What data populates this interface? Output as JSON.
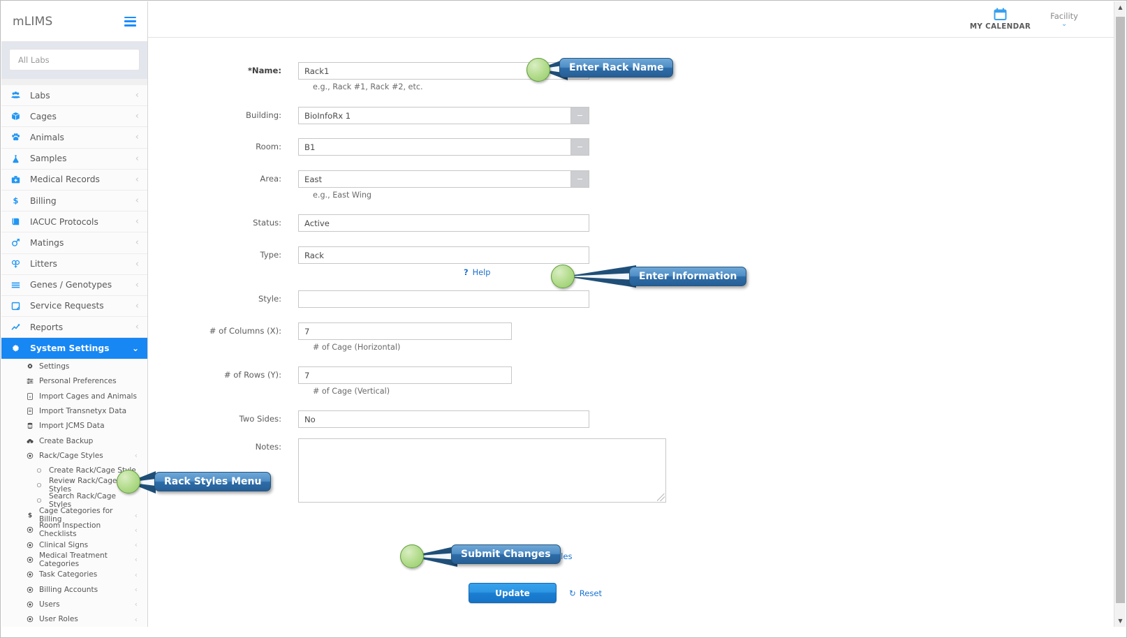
{
  "sidebar": {
    "brand": "mLIMS",
    "hamburger_icon": "hamburger-menu-icon",
    "lab_selector": {
      "value": "All Labs",
      "placeholder": "All Labs"
    },
    "nav_items": [
      {
        "label": "Labs",
        "icon": "users-group-icon",
        "chevron": "‹"
      },
      {
        "label": "Cages",
        "icon": "box-icon",
        "chevron": "‹"
      },
      {
        "label": "Animals",
        "icon": "paw-icon",
        "chevron": "‹"
      },
      {
        "label": "Samples",
        "icon": "flask-icon",
        "chevron": "‹"
      },
      {
        "label": "Medical Records",
        "icon": "medkit-icon",
        "chevron": "‹"
      },
      {
        "label": "Billing",
        "icon": "dollar-icon",
        "chevron": "‹"
      },
      {
        "label": "IACUC Protocols",
        "icon": "book-icon",
        "chevron": "‹"
      },
      {
        "label": "Matings",
        "icon": "mars-venus-icon",
        "chevron": "‹"
      },
      {
        "label": "Litters",
        "icon": "venus-double-icon",
        "chevron": "‹"
      },
      {
        "label": "Genes / Genotypes",
        "icon": "bars-icon",
        "chevron": "‹"
      },
      {
        "label": "Service Requests",
        "icon": "note-icon",
        "chevron": "‹"
      },
      {
        "label": "Reports",
        "icon": "line-chart-icon",
        "chevron": "‹"
      }
    ],
    "active_item": {
      "label": "System Settings",
      "icon": "gear-icon",
      "chevron": "⌄"
    },
    "sub_items": [
      {
        "label": "Settings",
        "icon": "gear-icon",
        "chevron": "",
        "deep": false
      },
      {
        "label": "Personal Preferences",
        "icon": "sliders-icon",
        "chevron": "",
        "deep": false
      },
      {
        "label": "Import Cages and Animals",
        "icon": "file-excel-icon",
        "chevron": "",
        "deep": false
      },
      {
        "label": "Import Transnetyx Data",
        "icon": "file-icon",
        "chevron": "",
        "deep": false
      },
      {
        "label": "Import JCMS Data",
        "icon": "database-icon",
        "chevron": "",
        "deep": false
      },
      {
        "label": "Create Backup",
        "icon": "cloud-download-icon",
        "chevron": "",
        "deep": false
      },
      {
        "label": "Rack/Cage Styles",
        "icon": "dot-circle-icon",
        "chevron": "‹",
        "deep": false
      },
      {
        "label": "Create Rack/Cage Style",
        "icon": "circle-o-icon",
        "chevron": "",
        "deep": true
      },
      {
        "label": "Review Rack/Cage Styles",
        "icon": "circle-o-icon",
        "chevron": "",
        "deep": true
      },
      {
        "label": "Search Rack/Cage Styles",
        "icon": "circle-o-icon",
        "chevron": "",
        "deep": true
      },
      {
        "label": "Cage Categories for Billing",
        "icon": "dollar-icon",
        "chevron": "‹",
        "deep": false
      },
      {
        "label": "Room Inspection Checklists",
        "icon": "dot-circle-icon",
        "chevron": "‹",
        "deep": false
      },
      {
        "label": "Clinical Signs",
        "icon": "dot-circle-icon",
        "chevron": "‹",
        "deep": false
      },
      {
        "label": "Medical Treatment Categories",
        "icon": "dot-circle-icon",
        "chevron": "‹",
        "deep": false
      },
      {
        "label": "Task Categories",
        "icon": "dot-circle-icon",
        "chevron": "‹",
        "deep": false
      },
      {
        "label": "Billing Accounts",
        "icon": "dot-circle-icon",
        "chevron": "‹",
        "deep": false
      },
      {
        "label": "Users",
        "icon": "dot-circle-icon",
        "chevron": "‹",
        "deep": false
      },
      {
        "label": "User Roles",
        "icon": "dot-circle-icon",
        "chevron": "‹",
        "deep": false
      }
    ]
  },
  "topbar": {
    "calendar_label": "MY CALENDAR",
    "calendar_icon": "calendar-icon",
    "facility_label": "Facility",
    "facility_chevron": "⌄"
  },
  "form": {
    "name": {
      "label": "*Name:",
      "value": "Rack1",
      "hint": "e.g., Rack #1, Rack #2, etc."
    },
    "building": {
      "label": "Building:",
      "value": "BioInfoRx 1",
      "hint": ""
    },
    "room": {
      "label": "Room:",
      "value": "B1",
      "hint": ""
    },
    "area": {
      "label": "Area:",
      "value": "East",
      "hint": "e.g., East Wing"
    },
    "status": {
      "label": "Status:",
      "value": "Active",
      "hint": ""
    },
    "type": {
      "label": "Type:",
      "value": "Rack",
      "hint": ""
    },
    "help": {
      "marker": "?",
      "label": "Help"
    },
    "style": {
      "label": "Style:",
      "value": "",
      "hint": ""
    },
    "columns": {
      "label": "# of Columns (X):",
      "value": "7",
      "hint": "# of Cage (Horizontal)"
    },
    "rows": {
      "label": "# of Rows (Y):",
      "value": "7",
      "hint": "# of Cage (Vertical)"
    },
    "two_sides": {
      "label": "Two Sides:",
      "value": "No",
      "hint": ""
    },
    "notes": {
      "label": "Notes:",
      "value": "",
      "hint": ""
    },
    "attach": {
      "label": "Click here to attach files",
      "icon": "paperclip-icon"
    },
    "update_button": "Update",
    "reset_button": "Reset"
  },
  "callouts": [
    {
      "text": "Enter Rack Name"
    },
    {
      "text": "Enter Information"
    },
    {
      "text": "Rack Styles Menu"
    },
    {
      "text": "Submit Changes"
    }
  ],
  "scrollbar": {
    "up_arrow": "▲",
    "down_arrow": "▼"
  },
  "colors": {
    "accent_blue": "#1787f3",
    "link_blue": "#1a73d1",
    "callout_blue": "#2d6ca8",
    "callout_dot_green": "#93cb68",
    "sidebar_bg": "#fbfbfb"
  }
}
